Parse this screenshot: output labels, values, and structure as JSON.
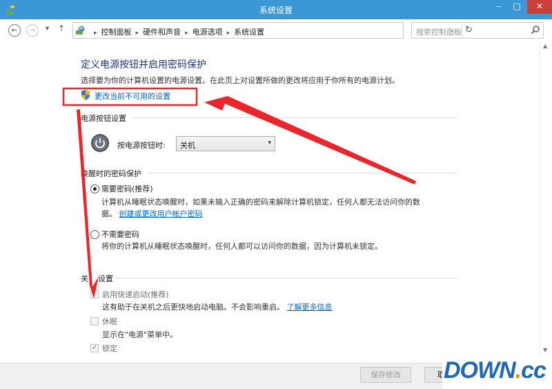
{
  "window": {
    "title": "系统设置"
  },
  "addressbar": {
    "breadcrumbs": [
      "控制面板",
      "硬件和声音",
      "电源选项",
      "系统设置"
    ],
    "search_placeholder": "搜索控制面板"
  },
  "page": {
    "title": "定义电源按钮并启用密码保护",
    "description": "选择要为你的计算机设置的电源设置。在此页上对设置所做的更改将应用于你所有的电源计划。",
    "change_unavailable_link": "更改当前不可用的设置"
  },
  "power_button": {
    "heading": "电源按钮设置",
    "label": "按电源按钮时:",
    "selected": "关机"
  },
  "wake_password": {
    "heading": "唤醒时的密码保护",
    "require": {
      "label": "需要密码(推荐)",
      "desc_line1": "计算机从睡眠状态唤醒时，如果未输入正确的密码来解除计算机锁定，任何人都无法访问你的数",
      "desc_line2": "据。",
      "link": "创建或更改用户帐户密码",
      "selected": true
    },
    "no_require": {
      "label": "不需要密码",
      "desc": "将你的计算机从睡眠状态唤醒时，任何人都可以访问你的数据，因为计算机未锁定。",
      "selected": false
    }
  },
  "shutdown": {
    "heading_part1": "关",
    "heading_part2": "设置",
    "fast_startup": {
      "label": "启用快速启动(推荐)",
      "desc": "这有助于在关机之后更快地启动电脑。不会影响重启。",
      "link": "了解更多信息",
      "checked": false
    },
    "sleep": {
      "label": "休眠",
      "desc": "显示在\"电源\"菜单中。",
      "checked": false
    },
    "lock": {
      "label": "锁定",
      "checked": true
    }
  },
  "footer": {
    "save": "保存修改",
    "cancel": "取消"
  },
  "watermark": {
    "main": "DOWN",
    "dot": ".",
    "cc": "cc"
  },
  "colors": {
    "titlebar": "#3c97d6",
    "annotation": "#e8262c",
    "link": "#0066cc",
    "heading": "#1e3287"
  }
}
